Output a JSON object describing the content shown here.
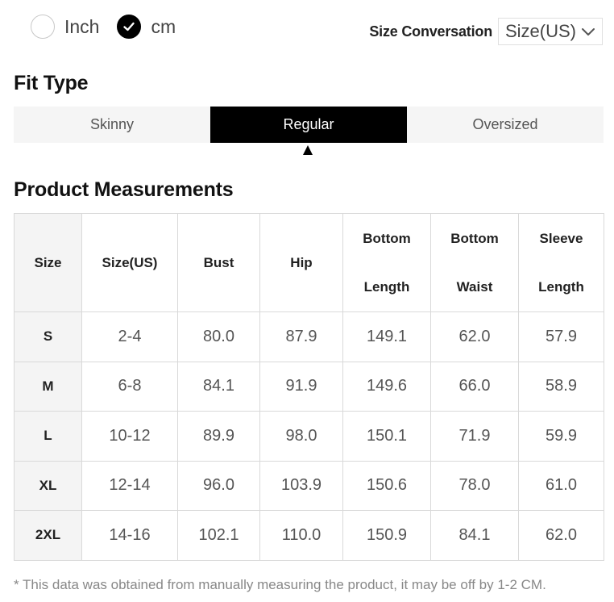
{
  "units": {
    "options": [
      {
        "label": "Inch",
        "checked": false
      },
      {
        "label": "cm",
        "checked": true
      }
    ]
  },
  "size_conversation": {
    "label": "Size Conversation",
    "selected": "Size(US)",
    "chevron_icon": "chevron-down-icon"
  },
  "fit_type": {
    "title": "Fit Type",
    "tabs": [
      "Skinny",
      "Regular",
      "Oversized"
    ],
    "active_index": 1
  },
  "measurements": {
    "title": "Product Measurements",
    "headers": [
      {
        "line1": "Size",
        "line2": ""
      },
      {
        "line1": "Size(US)",
        "line2": ""
      },
      {
        "line1": "Bust",
        "line2": ""
      },
      {
        "line1": "Hip",
        "line2": ""
      },
      {
        "line1": "Bottom",
        "line2": "Length"
      },
      {
        "line1": "Bottom",
        "line2": "Waist"
      },
      {
        "line1": "Sleeve",
        "line2": "Length"
      }
    ],
    "rows": [
      [
        "S",
        "2-4",
        "80.0",
        "87.9",
        "149.1",
        "62.0",
        "57.9"
      ],
      [
        "M",
        "6-8",
        "84.1",
        "91.9",
        "149.6",
        "66.0",
        "58.9"
      ],
      [
        "L",
        "10-12",
        "89.9",
        "98.0",
        "150.1",
        "71.9",
        "59.9"
      ],
      [
        "XL",
        "12-14",
        "96.0",
        "103.9",
        "150.6",
        "78.0",
        "61.0"
      ],
      [
        "2XL",
        "14-16",
        "102.1",
        "110.0",
        "150.9",
        "84.1",
        "62.0"
      ]
    ]
  },
  "footnote": "* This data was obtained from manually measuring the product, it may be off by 1-2 CM."
}
